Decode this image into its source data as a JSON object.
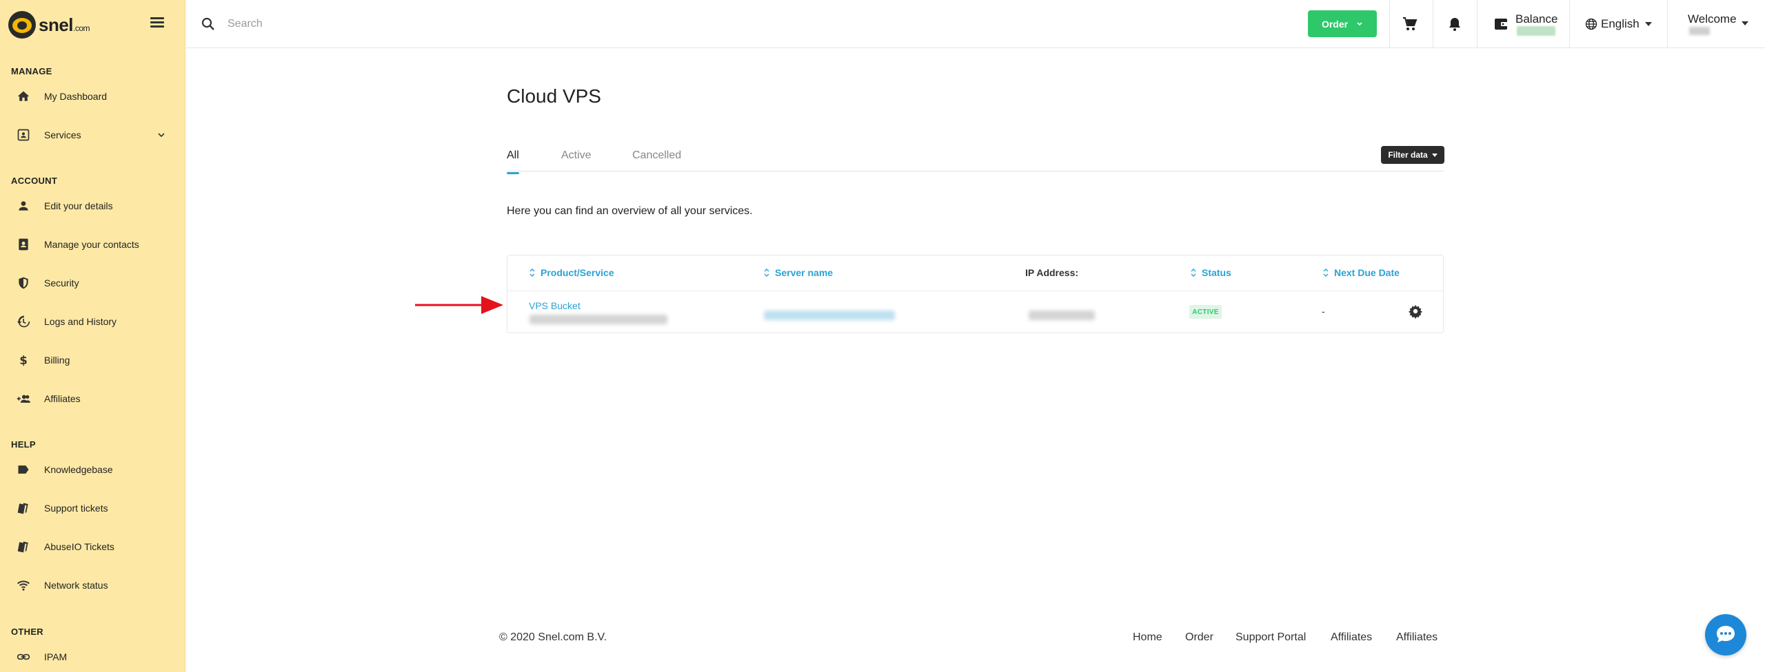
{
  "brand": {
    "name": "snel",
    "suffix": ".com"
  },
  "sidebar": {
    "sections": [
      {
        "title": "MANAGE"
      },
      {
        "title": "ACCOUNT"
      },
      {
        "title": "HELP"
      },
      {
        "title": "OTHER"
      }
    ],
    "items": [
      {
        "label": "My Dashboard",
        "icon": "home-icon"
      },
      {
        "label": "Services",
        "icon": "services-icon"
      },
      {
        "label": "Edit your details",
        "icon": "person-icon"
      },
      {
        "label": "Manage your contacts",
        "icon": "contacts-icon"
      },
      {
        "label": "Security",
        "icon": "shield-icon"
      },
      {
        "label": "Logs and History",
        "icon": "history-icon"
      },
      {
        "label": "Billing",
        "icon": "dollar-icon"
      },
      {
        "label": "Affiliates",
        "icon": "group-add-icon"
      },
      {
        "label": "Knowledgebase",
        "icon": "label-icon"
      },
      {
        "label": "Support tickets",
        "icon": "tickets-icon"
      },
      {
        "label": "AbuseIO Tickets",
        "icon": "tickets-icon"
      },
      {
        "label": "Network status",
        "icon": "wifi-icon"
      },
      {
        "label": "IPAM",
        "icon": "link-icon"
      }
    ]
  },
  "topbar": {
    "search_placeholder": "Search",
    "order_label": "Order",
    "balance_label": "Balance",
    "language": "English",
    "welcome": "Welcome"
  },
  "main": {
    "title": "Cloud VPS",
    "tabs": [
      {
        "label": "All",
        "active": true
      },
      {
        "label": "Active",
        "active": false
      },
      {
        "label": "Cancelled",
        "active": false
      }
    ],
    "filter_label": "Filter data",
    "overview": "Here you can find an overview of all your services.",
    "table": {
      "columns": [
        "Product/Service",
        "Server name",
        "IP Address:",
        "Status",
        "Next Due Date"
      ],
      "rows": [
        {
          "product": "VPS Bucket",
          "status": "ACTIVE",
          "next_due": "-"
        }
      ]
    }
  },
  "footer": {
    "copyright": "© 2020 Snel.com B.V.",
    "links": [
      "Home",
      "Order",
      "Support Portal",
      "Affiliates",
      "Affiliates"
    ]
  },
  "colors": {
    "sidebar_bg": "#fde9a5",
    "accent_blue": "#29a3d4",
    "order_green": "#2ec86b",
    "arrow_red": "#e5121c"
  }
}
